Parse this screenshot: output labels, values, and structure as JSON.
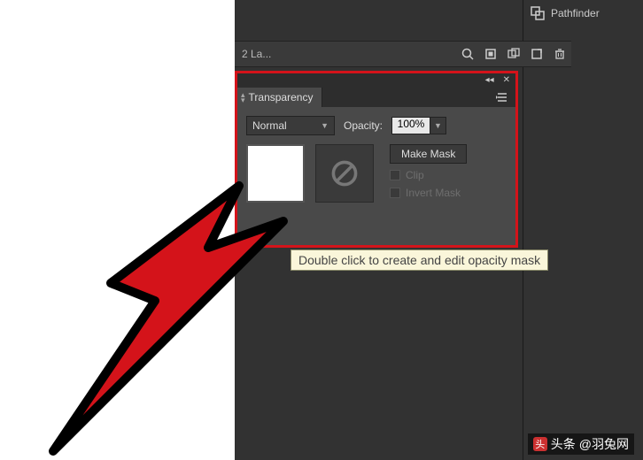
{
  "layers": {
    "text": "2 La..."
  },
  "pathfinder": {
    "label": "Pathfinder"
  },
  "panel": {
    "tab_label": "Transparency",
    "blend_mode": "Normal",
    "opacity_label": "Opacity:",
    "opacity_value": "100%",
    "make_mask_label": "Make Mask",
    "clip_label": "Clip",
    "invert_label": "Invert Mask"
  },
  "tooltip": {
    "text": "Double click to create and edit opacity mask"
  },
  "watermark": {
    "prefix": "头条",
    "handle": "@羽兔网"
  }
}
